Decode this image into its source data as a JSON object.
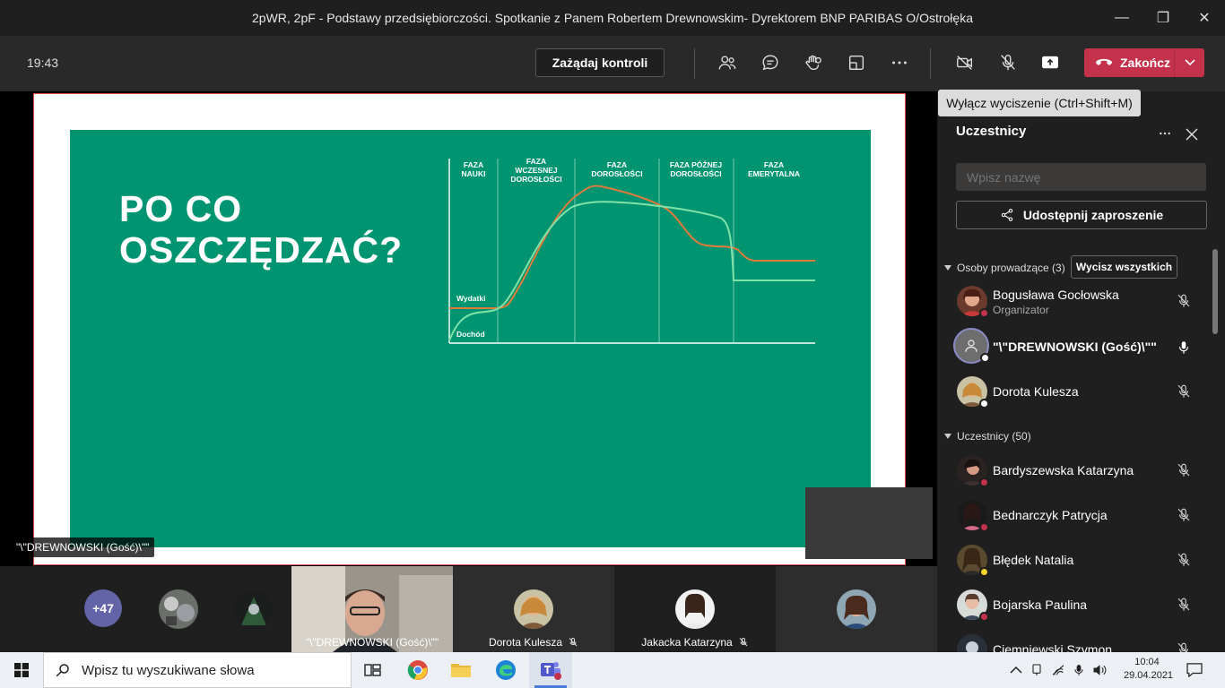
{
  "window": {
    "title": "2pWR, 2pF - Podstawy przedsiębiorczości. Spotkanie z Panem Robertem Drewnowskim- Dyrektorem BNP PARIBAS O/Ostrołęka"
  },
  "toolbar": {
    "clock": "19:43",
    "request_control_label": "Zażądaj kontroli",
    "end_label": "Zakończ",
    "tooltip": "Wyłącz wyciszenie (Ctrl+Shift+M)"
  },
  "slide": {
    "title_line1": "PO CO",
    "title_line2": "OSZCZĘDZAĆ?"
  },
  "chart_data": {
    "type": "line",
    "phases": [
      [
        "FAZA",
        "NAUKI"
      ],
      [
        "FAZA",
        "WCZESNEJ",
        "DOROSŁOŚCI"
      ],
      [
        "FAZA",
        "DOROSŁOŚCI"
      ],
      [
        "FAZA PÓŹNEJ",
        "DOROSŁOŚCI"
      ],
      [
        "FAZA",
        "EMERYTALNA"
      ]
    ],
    "series": [
      {
        "name": "Wydatki",
        "color": "#e07b3a"
      },
      {
        "name": "Dochód",
        "color": "#7fe3a8"
      }
    ]
  },
  "stage": {
    "presenter_label": "\"\\\"DREWNOWSKI (Gość)\\\"\""
  },
  "gallery": {
    "more_count": "+47",
    "tiles": [
      {
        "name": "\"\\\"DREWNOWSKI (Gość)\\\"\""
      },
      {
        "name": "Dorota Kulesza"
      },
      {
        "name": "Jakacka Katarzyna"
      }
    ]
  },
  "panel": {
    "title": "Uczestnicy",
    "search_placeholder": "Wpisz nazwę",
    "share_label": "Udostępnij zaproszenie",
    "presenters_header": "Osoby prowadzące (3)",
    "mute_all_label": "Wycisz wszystkich",
    "attendees_header": "Uczestnicy (50)",
    "presenters": [
      {
        "name": "Bogusława Gocłowska",
        "role": "Organizator"
      },
      {
        "name": "\"\\\"DREWNOWSKI (Gość)\\\"\""
      },
      {
        "name": "Dorota Kulesza"
      }
    ],
    "attendees": [
      {
        "name": "Bardyszewska Katarzyna"
      },
      {
        "name": "Bednarczyk Patrycja"
      },
      {
        "name": "Błędek Natalia"
      },
      {
        "name": "Bojarska Paulina"
      },
      {
        "name": "Ciemniewski Szymon"
      }
    ]
  },
  "taskbar": {
    "search_placeholder": "Wpisz tu wyszukiwane słowa",
    "time": "10:04",
    "date": "29.04.2021"
  },
  "colors": {
    "slide_green": "#009470",
    "end_red": "#c4314b",
    "accent": "#6264a7"
  }
}
